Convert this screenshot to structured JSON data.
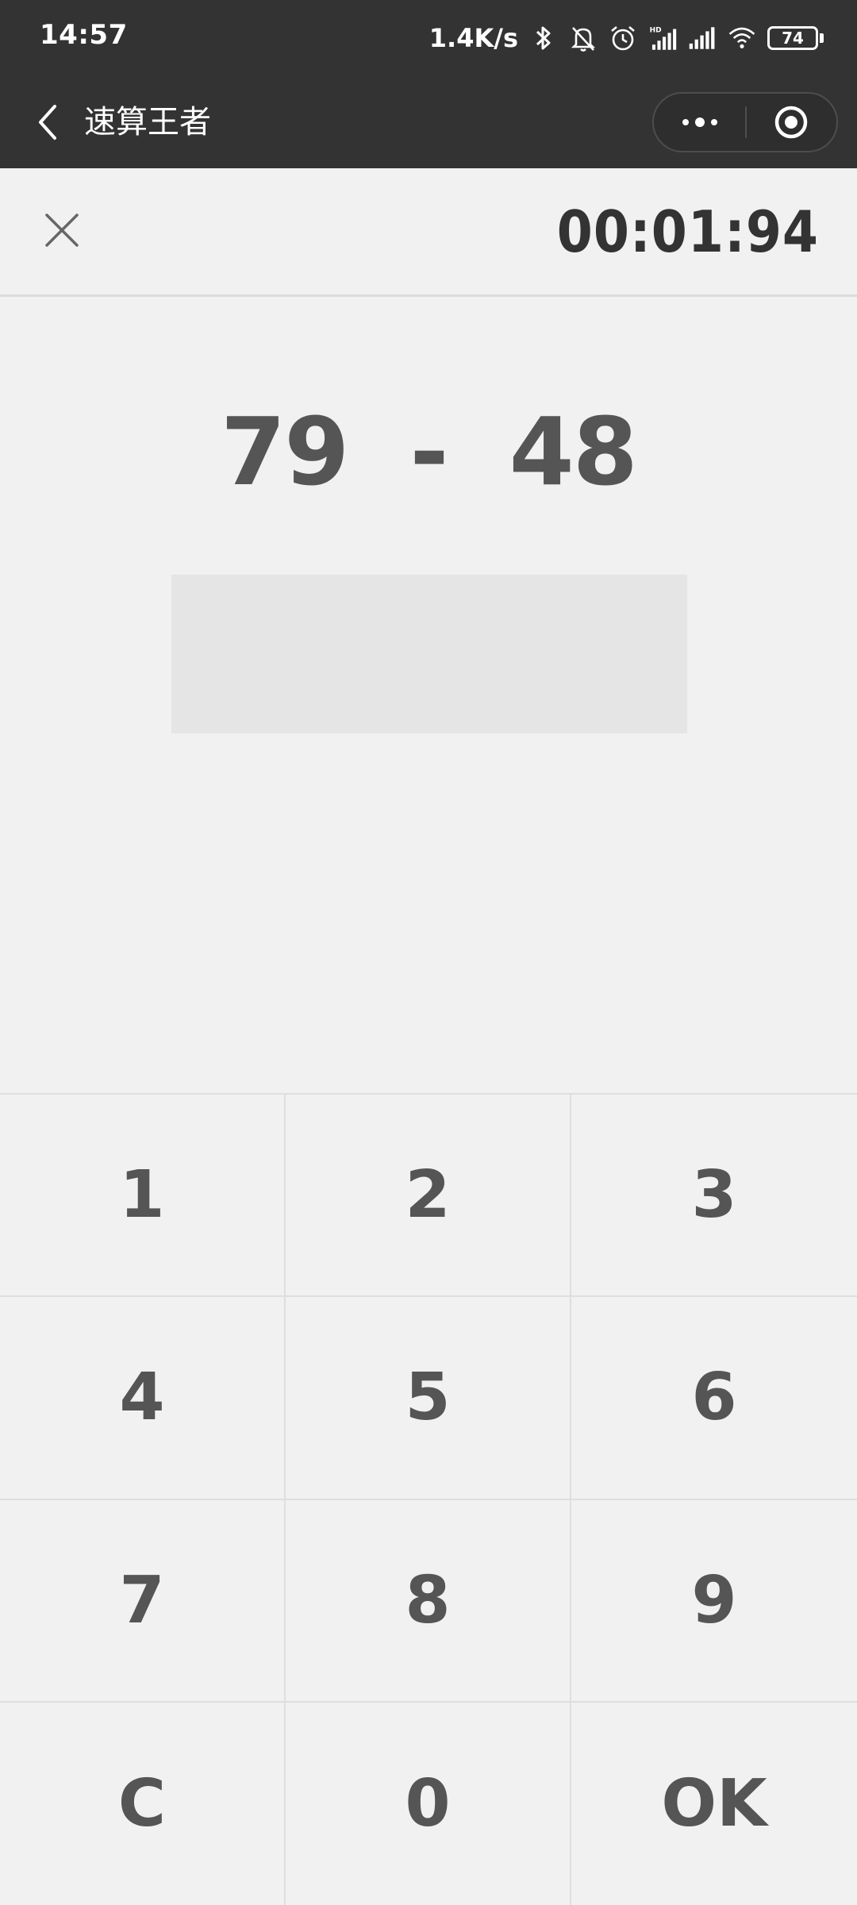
{
  "status_bar": {
    "time": "14:57",
    "net_speed": "1.4K/s",
    "battery": "74",
    "icons": [
      "bluetooth-icon",
      "mute-bell-icon",
      "alarm-icon",
      "hd-signal-icon",
      "signal-icon",
      "wifi-icon",
      "battery-icon"
    ]
  },
  "nav": {
    "title": "速算王者"
  },
  "game": {
    "timer": "00:01:94",
    "question": "79  -  48",
    "answer": ""
  },
  "keypad": {
    "keys": [
      "1",
      "2",
      "3",
      "4",
      "5",
      "6",
      "7",
      "8",
      "9",
      "C",
      "0",
      "OK"
    ]
  },
  "colors": {
    "bar_bg": "#333333",
    "page_bg": "#f1f1f1",
    "answer_bg": "#e5e5e5",
    "key_text": "#555555",
    "timer_text": "#333333"
  }
}
